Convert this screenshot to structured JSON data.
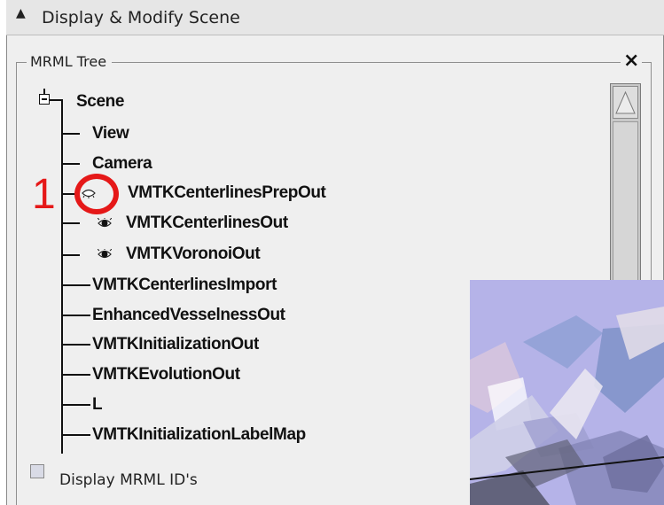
{
  "header": {
    "arrow_icon": "triangle-up-icon",
    "title": "Display & Modify Scene"
  },
  "tree_panel": {
    "label": "MRML Tree",
    "close_label": "×",
    "root": {
      "label": "Scene",
      "children": [
        "View",
        "Camera",
        "VMTKCenterlinesPrepOut",
        "VMTKCenterlinesOut",
        "VMTKVoronoiOut",
        "VMTKCenterlinesImport",
        "EnhancedVesselnessOut",
        "VMTKInitializationOut",
        "VMTKEvolutionOut",
        "L",
        "VMTKInitializationLabelMap"
      ]
    }
  },
  "display_ids": {
    "label": "Display MRML ID's",
    "checked": false
  },
  "annotation": {
    "number": "1",
    "color": "#e51818"
  },
  "colors": {
    "viewer_background": "#b5b3e8",
    "panel_background": "#efefef"
  }
}
